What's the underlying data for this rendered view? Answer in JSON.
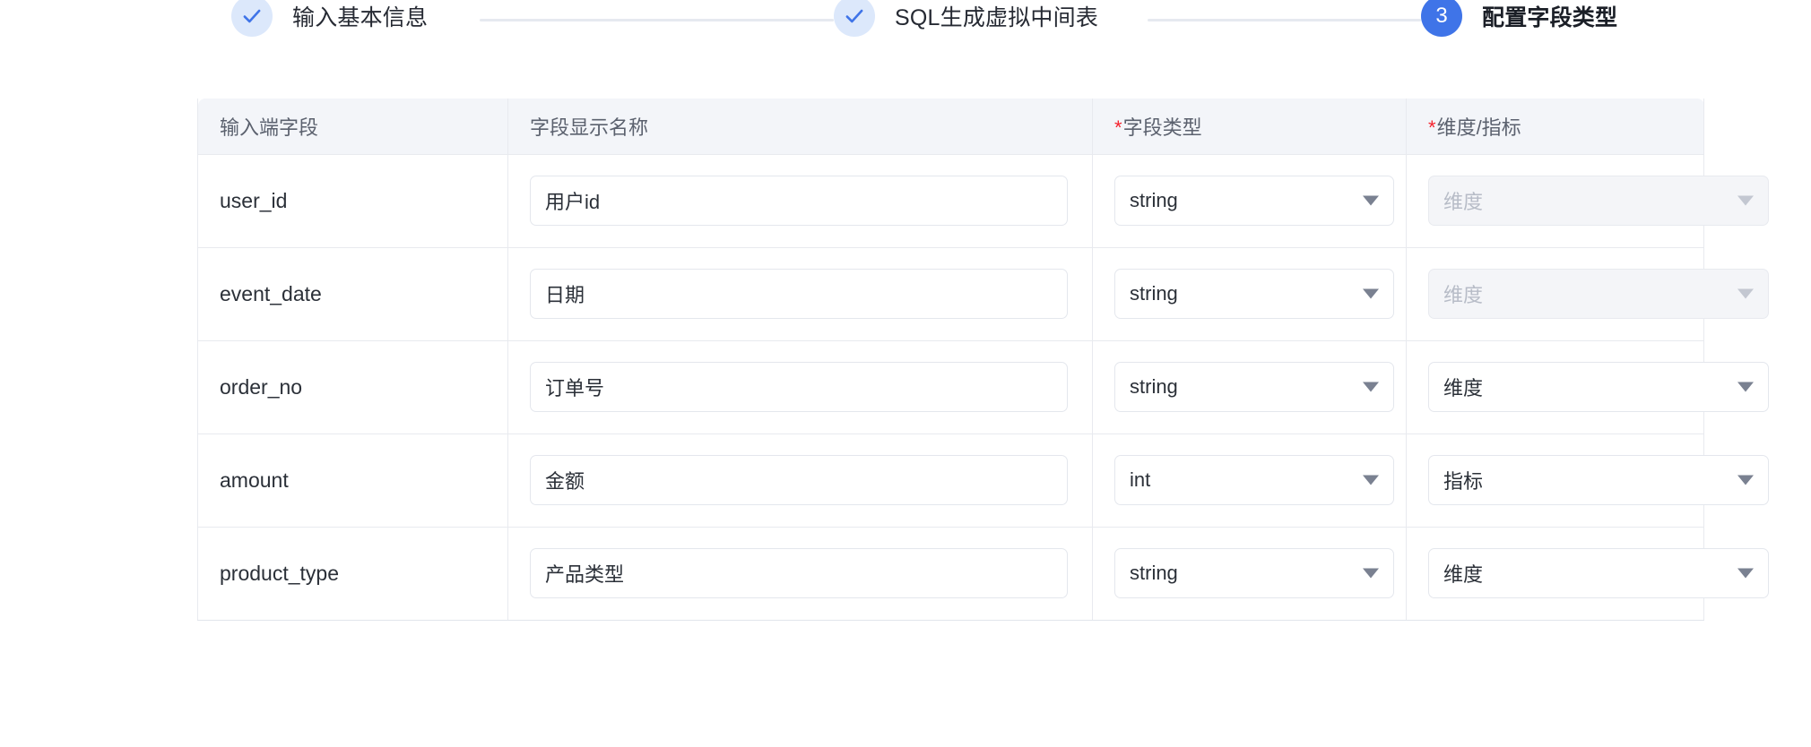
{
  "stepper": {
    "steps": [
      {
        "label": "输入基本信息",
        "state": "done",
        "icon": "check-icon"
      },
      {
        "label": "SQL生成虚拟中间表",
        "state": "done",
        "icon": "check-icon"
      },
      {
        "label": "配置字段类型",
        "state": "active",
        "number": "3"
      }
    ],
    "colors": {
      "done_badge_bg": "#dce8fb",
      "done_check": "#3f74e8",
      "active_badge_bg": "#3f74e8",
      "connector": "#e6e9f0"
    }
  },
  "table": {
    "columns": [
      {
        "header": "输入端字段",
        "required": false
      },
      {
        "header": "字段显示名称",
        "required": false
      },
      {
        "header": "字段类型",
        "required": true
      },
      {
        "header": "维度/指标",
        "required": true
      }
    ],
    "required_marker": "*",
    "rows": [
      {
        "field": "user_id",
        "display_name": "用户id",
        "field_type": "string",
        "dim_metric": "维度",
        "dim_metric_disabled": true
      },
      {
        "field": "event_date",
        "display_name": "日期",
        "field_type": "string",
        "dim_metric": "维度",
        "dim_metric_disabled": true
      },
      {
        "field": "order_no",
        "display_name": "订单号",
        "field_type": "string",
        "dim_metric": "维度",
        "dim_metric_disabled": false
      },
      {
        "field": "amount",
        "display_name": "金额",
        "field_type": "int",
        "dim_metric": "指标",
        "dim_metric_disabled": false
      },
      {
        "field": "product_type",
        "display_name": "产品类型",
        "field_type": "string",
        "dim_metric": "维度",
        "dim_metric_disabled": false
      }
    ]
  }
}
